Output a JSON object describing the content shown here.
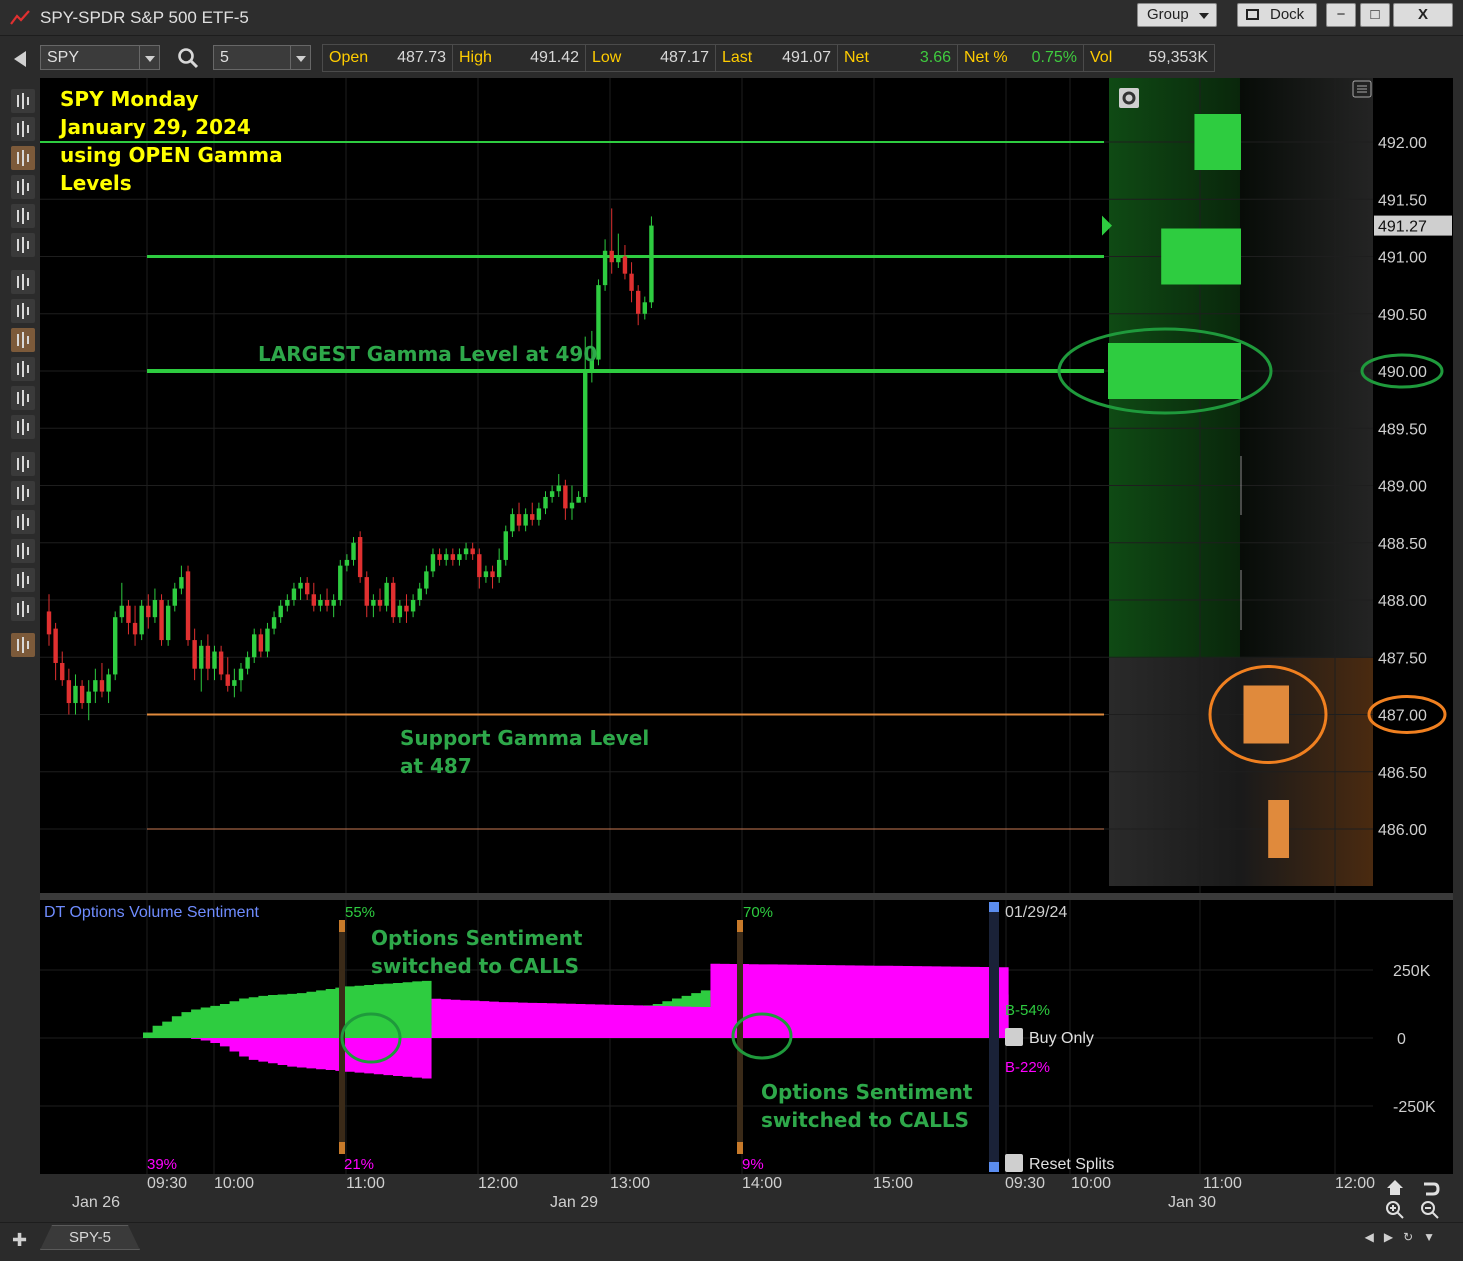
{
  "window": {
    "title": "SPY-SPDR S&P 500 ETF-5",
    "group_label": "Group",
    "dock_label": "Dock",
    "minimize": "−",
    "maximize": "□",
    "close": "X"
  },
  "toolbar": {
    "symbol": "SPY",
    "interval": "5",
    "quote": [
      {
        "label": "Open",
        "value": "487.73"
      },
      {
        "label": "High",
        "value": "491.42"
      },
      {
        "label": "Low",
        "value": "487.17"
      },
      {
        "label": "Last",
        "value": "491.07"
      },
      {
        "label": "Net",
        "value": "3.66",
        "highlight": true
      },
      {
        "label": "Net %",
        "value": "0.75%",
        "highlight": true
      },
      {
        "label": "Vol",
        "value": "59,353K"
      }
    ]
  },
  "left_tools": [
    "cursor-cross-icon",
    "crosshair-icon",
    "candlestick-icon",
    "ohlc-bar-icon",
    "line-chart-icon",
    "area-chart-icon",
    "vertical-scale-icon",
    "trendline-icon",
    "grid-icon",
    "table-icon",
    "small-grid-icon",
    "split-icon",
    "bar-marker-icon",
    "tick-marker-icon",
    "home-icon",
    "undo-icon",
    "zoom-in-icon",
    "zoom-out-icon",
    "pointer-icon"
  ],
  "annotations": {
    "title_lines": [
      "SPY Monday",
      "January 29, 2024",
      "using OPEN Gamma",
      "Levels"
    ],
    "largest_gamma": "LARGEST Gamma Level at 490",
    "support_gamma": [
      "Support Gamma Level",
      "at 487"
    ],
    "sentiment_switch_1": [
      "Options Sentiment",
      "switched to CALLS"
    ],
    "sentiment_switch_2": [
      "Options Sentiment",
      "switched to CALLS"
    ]
  },
  "price_axis": {
    "labels": [
      "492.00",
      "491.50",
      "491.00",
      "490.50",
      "490.00",
      "489.50",
      "489.00",
      "488.50",
      "488.00",
      "487.50",
      "487.00",
      "486.50",
      "486.00"
    ],
    "last_price": "491.27"
  },
  "gamma_levels": {
    "resistance": [
      492,
      491,
      490
    ],
    "support": [
      487,
      486
    ],
    "largest": 490
  },
  "indicator": {
    "name": "DT Options Volume Sentiment",
    "date": "01/29/24",
    "axis_labels": [
      "250K",
      "0",
      "-250K"
    ],
    "pct_top": [
      "55%",
      "70%"
    ],
    "pct_bottom": [
      "39%",
      "21%",
      "9%"
    ],
    "buy_pct": "B-54%",
    "sell_pct": "B-22%",
    "buy_only_label": "Buy Only",
    "reset_splits_label": "Reset Splits"
  },
  "time_axis": {
    "times": [
      "09:30",
      "10:00",
      "11:00",
      "12:00",
      "13:00",
      "14:00",
      "15:00",
      "09:30",
      "10:00",
      "11:00",
      "12:00"
    ],
    "dates": [
      "Jan 26",
      "Jan 29",
      "Jan 30"
    ]
  },
  "tabs": [
    {
      "label": "SPY-5"
    }
  ],
  "colors": {
    "up": "#2ecc40",
    "down": "#e03030",
    "gamma_green": "#2ecc40",
    "gamma_orange": "#e08a3c",
    "annotation_yellow": "#ffff00",
    "annotation_green": "#2ea84a",
    "magenta": "#ff00ff"
  },
  "chart_data": {
    "type": "candlestick",
    "title": "SPY-SPDR S&P 500 ETF-5",
    "ylim": [
      485.6,
      492.6
    ],
    "y_ticks": [
      486.0,
      486.5,
      487.0,
      487.5,
      488.0,
      488.5,
      489.0,
      489.5,
      490.0,
      490.5,
      491.0,
      491.5,
      492.0
    ],
    "bar_minutes": 5,
    "sessions": [
      "Jan 26",
      "Jan 29"
    ],
    "candles": [
      {
        "t": "Jan 26 15:30",
        "o": 487.9,
        "h": 488.05,
        "l": 487.6,
        "c": 487.7
      },
      {
        "t": "Jan 26 15:35",
        "o": 487.75,
        "h": 487.8,
        "l": 487.3,
        "c": 487.45
      },
      {
        "t": "Jan 26 15:40",
        "o": 487.45,
        "h": 487.55,
        "l": 487.25,
        "c": 487.3
      },
      {
        "t": "Jan 26 15:45",
        "o": 487.3,
        "h": 487.4,
        "l": 487.0,
        "c": 487.1
      },
      {
        "t": "Jan 26 15:50",
        "o": 487.1,
        "h": 487.35,
        "l": 487.0,
        "c": 487.25
      },
      {
        "t": "Jan 26 15:55",
        "o": 487.25,
        "h": 487.3,
        "l": 487.05,
        "c": 487.1
      },
      {
        "t": "Jan 29 09:30",
        "o": 487.1,
        "h": 487.3,
        "l": 486.95,
        "c": 487.2
      },
      {
        "t": "Jan 29 09:35",
        "o": 487.2,
        "h": 487.4,
        "l": 487.1,
        "c": 487.3
      },
      {
        "t": "Jan 29 09:40",
        "o": 487.3,
        "h": 487.45,
        "l": 487.15,
        "c": 487.2
      },
      {
        "t": "Jan 29 09:45",
        "o": 487.2,
        "h": 487.4,
        "l": 487.1,
        "c": 487.35
      },
      {
        "t": "Jan 29 09:50",
        "o": 487.35,
        "h": 487.9,
        "l": 487.3,
        "c": 487.85
      },
      {
        "t": "Jan 29 09:55",
        "o": 487.85,
        "h": 488.15,
        "l": 487.8,
        "c": 487.95
      },
      {
        "t": "Jan 29 10:00",
        "o": 487.95,
        "h": 488.0,
        "l": 487.7,
        "c": 487.8
      },
      {
        "t": "Jan 29 10:05",
        "o": 487.8,
        "h": 487.95,
        "l": 487.6,
        "c": 487.7
      },
      {
        "t": "Jan 29 10:10",
        "o": 487.7,
        "h": 488.0,
        "l": 487.65,
        "c": 487.95
      },
      {
        "t": "Jan 29 10:15",
        "o": 487.95,
        "h": 488.05,
        "l": 487.75,
        "c": 487.85
      },
      {
        "t": "Jan 29 10:20",
        "o": 487.85,
        "h": 488.1,
        "l": 487.8,
        "c": 488.0
      },
      {
        "t": "Jan 29 10:25",
        "o": 488.0,
        "h": 488.05,
        "l": 487.6,
        "c": 487.65
      },
      {
        "t": "Jan 29 10:30",
        "o": 487.65,
        "h": 488.0,
        "l": 487.6,
        "c": 487.95
      },
      {
        "t": "Jan 29 10:35",
        "o": 487.95,
        "h": 488.15,
        "l": 487.9,
        "c": 488.1
      },
      {
        "t": "Jan 29 10:40",
        "o": 488.1,
        "h": 488.3,
        "l": 488.05,
        "c": 488.2
      },
      {
        "t": "Jan 29 10:45",
        "o": 488.25,
        "h": 488.3,
        "l": 487.6,
        "c": 487.65
      },
      {
        "t": "Jan 29 10:50",
        "o": 487.65,
        "h": 487.75,
        "l": 487.3,
        "c": 487.4
      },
      {
        "t": "Jan 29 10:55",
        "o": 487.4,
        "h": 487.65,
        "l": 487.2,
        "c": 487.6
      },
      {
        "t": "Jan 29 11:00",
        "o": 487.6,
        "h": 487.7,
        "l": 487.3,
        "c": 487.4
      },
      {
        "t": "Jan 29 11:05",
        "o": 487.4,
        "h": 487.6,
        "l": 487.3,
        "c": 487.55
      },
      {
        "t": "Jan 29 11:10",
        "o": 487.55,
        "h": 487.6,
        "l": 487.3,
        "c": 487.35
      },
      {
        "t": "Jan 29 11:15",
        "o": 487.35,
        "h": 487.5,
        "l": 487.2,
        "c": 487.25
      },
      {
        "t": "Jan 29 11:20",
        "o": 487.25,
        "h": 487.4,
        "l": 487.15,
        "c": 487.3
      },
      {
        "t": "Jan 29 11:25",
        "o": 487.3,
        "h": 487.45,
        "l": 487.2,
        "c": 487.4
      },
      {
        "t": "Jan 29 11:30",
        "o": 487.4,
        "h": 487.55,
        "l": 487.35,
        "c": 487.5
      },
      {
        "t": "Jan 29 11:35",
        "o": 487.5,
        "h": 487.75,
        "l": 487.45,
        "c": 487.7
      },
      {
        "t": "Jan 29 11:40",
        "o": 487.7,
        "h": 487.75,
        "l": 487.5,
        "c": 487.55
      },
      {
        "t": "Jan 29 11:45",
        "o": 487.55,
        "h": 487.8,
        "l": 487.5,
        "c": 487.75
      },
      {
        "t": "Jan 29 11:50",
        "o": 487.75,
        "h": 487.9,
        "l": 487.7,
        "c": 487.85
      },
      {
        "t": "Jan 29 11:55",
        "o": 487.85,
        "h": 488.0,
        "l": 487.8,
        "c": 487.95
      },
      {
        "t": "Jan 29 12:00",
        "o": 487.95,
        "h": 488.05,
        "l": 487.9,
        "c": 488.0
      },
      {
        "t": "Jan 29 12:05",
        "o": 488.0,
        "h": 488.15,
        "l": 487.95,
        "c": 488.1
      },
      {
        "t": "Jan 29 12:10",
        "o": 488.1,
        "h": 488.2,
        "l": 488.0,
        "c": 488.15
      },
      {
        "t": "Jan 29 12:15",
        "o": 488.15,
        "h": 488.2,
        "l": 488.0,
        "c": 488.05
      },
      {
        "t": "Jan 29 12:20",
        "o": 488.05,
        "h": 488.15,
        "l": 487.9,
        "c": 487.95
      },
      {
        "t": "Jan 29 12:25",
        "o": 487.95,
        "h": 488.05,
        "l": 487.9,
        "c": 488.0
      },
      {
        "t": "Jan 29 12:30",
        "o": 488.0,
        "h": 488.1,
        "l": 487.9,
        "c": 487.95
      },
      {
        "t": "Jan 29 12:35",
        "o": 487.95,
        "h": 488.05,
        "l": 487.85,
        "c": 488.0
      },
      {
        "t": "Jan 29 12:40",
        "o": 488.0,
        "h": 488.35,
        "l": 487.95,
        "c": 488.3
      },
      {
        "t": "Jan 29 12:45",
        "o": 488.3,
        "h": 488.4,
        "l": 488.25,
        "c": 488.35
      },
      {
        "t": "Jan 29 12:50",
        "o": 488.35,
        "h": 488.55,
        "l": 488.3,
        "c": 488.5
      },
      {
        "t": "Jan 29 12:55",
        "o": 488.55,
        "h": 488.6,
        "l": 488.15,
        "c": 488.2
      },
      {
        "t": "Jan 29 13:00",
        "o": 488.2,
        "h": 488.25,
        "l": 487.85,
        "c": 487.95
      },
      {
        "t": "Jan 29 13:05",
        "o": 487.95,
        "h": 488.05,
        "l": 487.85,
        "c": 488.0
      },
      {
        "t": "Jan 29 13:10",
        "o": 488.0,
        "h": 488.1,
        "l": 487.9,
        "c": 487.95
      },
      {
        "t": "Jan 29 13:15",
        "o": 487.95,
        "h": 488.2,
        "l": 487.9,
        "c": 488.15
      },
      {
        "t": "Jan 29 13:20",
        "o": 488.15,
        "h": 488.2,
        "l": 487.8,
        "c": 487.85
      },
      {
        "t": "Jan 29 13:25",
        "o": 487.85,
        "h": 488.0,
        "l": 487.8,
        "c": 487.95
      },
      {
        "t": "Jan 29 13:30",
        "o": 487.95,
        "h": 488.05,
        "l": 487.8,
        "c": 487.9
      },
      {
        "t": "Jan 29 13:35",
        "o": 487.9,
        "h": 488.05,
        "l": 487.85,
        "c": 488.0
      },
      {
        "t": "Jan 29 13:40",
        "o": 488.0,
        "h": 488.15,
        "l": 487.95,
        "c": 488.1
      },
      {
        "t": "Jan 29 13:45",
        "o": 488.1,
        "h": 488.3,
        "l": 488.05,
        "c": 488.25
      },
      {
        "t": "Jan 29 13:50",
        "o": 488.25,
        "h": 488.45,
        "l": 488.2,
        "c": 488.4
      },
      {
        "t": "Jan 29 13:55",
        "o": 488.4,
        "h": 488.45,
        "l": 488.3,
        "c": 488.35
      },
      {
        "t": "Jan 29 14:00",
        "o": 488.35,
        "h": 488.45,
        "l": 488.3,
        "c": 488.4
      },
      {
        "t": "Jan 29 14:05",
        "o": 488.4,
        "h": 488.45,
        "l": 488.3,
        "c": 488.35
      },
      {
        "t": "Jan 29 14:10",
        "o": 488.35,
        "h": 488.45,
        "l": 488.3,
        "c": 488.4
      },
      {
        "t": "Jan 29 14:15",
        "o": 488.4,
        "h": 488.5,
        "l": 488.35,
        "c": 488.45
      },
      {
        "t": "Jan 29 14:20",
        "o": 488.45,
        "h": 488.5,
        "l": 488.35,
        "c": 488.4
      },
      {
        "t": "Jan 29 14:25",
        "o": 488.4,
        "h": 488.45,
        "l": 488.1,
        "c": 488.2
      },
      {
        "t": "Jan 29 14:30",
        "o": 488.2,
        "h": 488.3,
        "l": 488.15,
        "c": 488.25
      },
      {
        "t": "Jan 29 14:35",
        "o": 488.25,
        "h": 488.3,
        "l": 488.1,
        "c": 488.2
      },
      {
        "t": "Jan 29 14:40",
        "o": 488.2,
        "h": 488.45,
        "l": 488.15,
        "c": 488.35
      },
      {
        "t": "Jan 29 14:45",
        "o": 488.35,
        "h": 488.65,
        "l": 488.3,
        "c": 488.6
      },
      {
        "t": "Jan 29 14:50",
        "o": 488.6,
        "h": 488.8,
        "l": 488.55,
        "c": 488.75
      },
      {
        "t": "Jan 29 14:55",
        "o": 488.75,
        "h": 488.85,
        "l": 488.6,
        "c": 488.65
      },
      {
        "t": "Jan 29 15:00",
        "o": 488.65,
        "h": 488.8,
        "l": 488.6,
        "c": 488.75
      },
      {
        "t": "Jan 29 15:05",
        "o": 488.75,
        "h": 488.85,
        "l": 488.65,
        "c": 488.7
      },
      {
        "t": "Jan 29 15:10",
        "o": 488.7,
        "h": 488.85,
        "l": 488.65,
        "c": 488.8
      },
      {
        "t": "Jan 29 15:15",
        "o": 488.8,
        "h": 488.95,
        "l": 488.75,
        "c": 488.9
      },
      {
        "t": "Jan 29 15:20",
        "o": 488.9,
        "h": 489.0,
        "l": 488.85,
        "c": 488.95
      },
      {
        "t": "Jan 29 15:25",
        "o": 488.95,
        "h": 489.1,
        "l": 488.9,
        "c": 489.0
      },
      {
        "t": "Jan 29 15:30",
        "o": 489.0,
        "h": 489.05,
        "l": 488.7,
        "c": 488.8
      },
      {
        "t": "Jan 29 15:35",
        "o": 488.8,
        "h": 489.0,
        "l": 488.7,
        "c": 488.85
      },
      {
        "t": "Jan 29 15:40",
        "o": 488.85,
        "h": 488.95,
        "l": 488.85,
        "c": 488.9
      },
      {
        "t": "Jan 29 15:45",
        "o": 488.9,
        "h": 490.3,
        "l": 488.85,
        "c": 490.0
      },
      {
        "t": "Jan 29 15:50",
        "o": 490.0,
        "h": 490.35,
        "l": 489.9,
        "c": 490.1
      },
      {
        "t": "Jan 29 15:55",
        "o": 490.1,
        "h": 490.8,
        "l": 490.05,
        "c": 490.75
      },
      {
        "t": "Jan 29 16:00",
        "o": 490.75,
        "h": 491.15,
        "l": 490.7,
        "c": 491.05
      },
      {
        "t": "Jan 29 16:05",
        "o": 491.05,
        "h": 491.42,
        "l": 490.85,
        "c": 490.95
      },
      {
        "t": "Jan 29 16:10",
        "o": 490.95,
        "h": 491.2,
        "l": 490.9,
        "c": 491.0
      },
      {
        "t": "Jan 29 16:15",
        "o": 491.0,
        "h": 491.1,
        "l": 490.8,
        "c": 490.85
      },
      {
        "t": "Jan 29 16:20",
        "o": 490.85,
        "h": 490.95,
        "l": 490.6,
        "c": 490.7
      },
      {
        "t": "Jan 29 16:25",
        "o": 490.7,
        "h": 490.75,
        "l": 490.4,
        "c": 490.5
      },
      {
        "t": "Jan 29 16:30",
        "o": 490.5,
        "h": 490.65,
        "l": 490.45,
        "c": 490.6
      },
      {
        "t": "Jan 29 16:35",
        "o": 490.6,
        "h": 491.35,
        "l": 490.55,
        "c": 491.27
      }
    ],
    "gamma_bars": [
      {
        "price": 492.0,
        "magnitude": 0.35,
        "side": "call"
      },
      {
        "price": 491.0,
        "magnitude": 0.6,
        "side": "call"
      },
      {
        "price": 490.0,
        "magnitude": 1.0,
        "side": "call"
      },
      {
        "price": 487.0,
        "magnitude": 0.35,
        "side": "put"
      },
      {
        "price": 486.0,
        "magnitude": 0.16,
        "side": "put"
      }
    ],
    "sentiment": {
      "ylim": [
        -370000,
        370000
      ],
      "calls_k": [
        20,
        45,
        60,
        80,
        95,
        105,
        112,
        118,
        125,
        135,
        145,
        150,
        155,
        158,
        160,
        162,
        165,
        170,
        175,
        180,
        185,
        190,
        192,
        195,
        198,
        200,
        202,
        205,
        208,
        210,
        212,
        215,
        218,
        220,
        222,
        225,
        228,
        230,
        232,
        235,
        238,
        240,
        242,
        245,
        248,
        250,
        255,
        260,
        265,
        270,
        275,
        280,
        285,
        290,
        300,
        310,
        320,
        330,
        340,
        350,
        360,
        370,
        380,
        390,
        400,
        405,
        410,
        412,
        415,
        418,
        420,
        425,
        430,
        440,
        445,
        450,
        455,
        460,
        465,
        470,
        480,
        490,
        495,
        500,
        505,
        510,
        512,
        515,
        518,
        520
      ],
      "puts_k": [
        0,
        0,
        0,
        0,
        0,
        -5,
        -15,
        -30,
        -50,
        -80,
        -110,
        -130,
        -140,
        -150,
        -160,
        -170,
        -175,
        -180,
        -185,
        -190,
        -195,
        -200,
        -205,
        -210,
        -215,
        -220,
        -225,
        -230,
        -235,
        -240,
        -245,
        -250,
        -255,
        -260,
        -265,
        -270,
        -275,
        -280,
        -282,
        -285,
        -288,
        -290,
        -292,
        -295,
        -298,
        -300,
        -302,
        -305,
        -308,
        -310,
        -312,
        -315,
        -318,
        -320,
        -322,
        -325,
        -328,
        -330,
        -332,
        -335,
        -338,
        -340,
        -342,
        -345,
        -348,
        -350,
        -352,
        -355,
        -358,
        -360,
        -362,
        -365,
        -368,
        -370,
        -372,
        -375,
        -378,
        -380,
        -382,
        -385,
        -388,
        -390,
        -392,
        -395,
        -398,
        -400,
        -402,
        -405,
        -408,
        -410
      ],
      "buy_share_pct": 54,
      "sell_share_pct": 22
    }
  }
}
